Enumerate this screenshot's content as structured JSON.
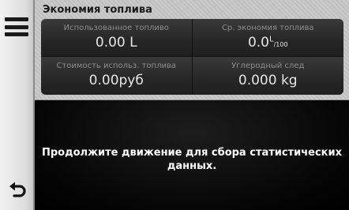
{
  "sidebar": {
    "menu_icon": "hamburger-menu-icon",
    "back_icon": "back-arrow-icon"
  },
  "panel": {
    "title": "Экономия топлива",
    "stats": [
      {
        "label": "Использованное топливо",
        "value": "0.00 L"
      },
      {
        "label": "Ср. экономия топлива",
        "value_main": "0.0",
        "value_sup": "L",
        "value_sub": "/100"
      },
      {
        "label": "Стоимость использ. топлива",
        "value": "0.00руб"
      },
      {
        "label": "Углеродный след",
        "value": "0.000 kg"
      }
    ]
  },
  "message": "Продолжите движение для сбора статистических данных.",
  "colors": {
    "panel_bg": "#c7c7c7",
    "cell_bg": "#262626",
    "sidebar_bg": "#e6e6e6",
    "message_text": "#ffffff"
  }
}
